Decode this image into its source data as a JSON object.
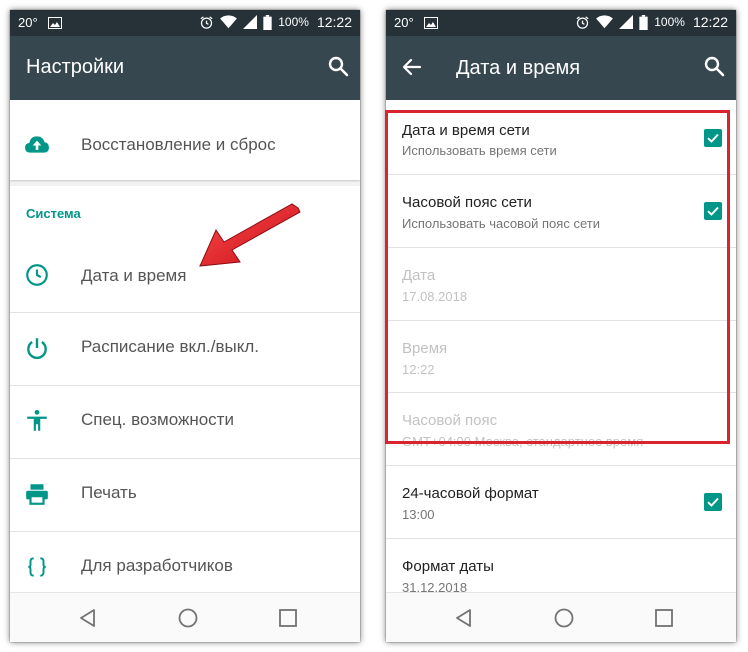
{
  "colors": {
    "statusbar_bg": "#263238",
    "appbar_bg": "#37474f",
    "accent_teal": "#009688",
    "highlight_red": "#d9232e"
  },
  "left": {
    "status": {
      "temp": "20°",
      "battery": "100%",
      "time": "12:22"
    },
    "title": "Настройки",
    "items_top": [
      {
        "label": "Восстановление и сброс",
        "icon": "cloud-upload-icon"
      }
    ],
    "section_header": "Система",
    "system_items": [
      {
        "label": "Дата и время",
        "icon": "clock-icon"
      },
      {
        "label": "Расписание вкл./выкл.",
        "icon": "power-icon"
      },
      {
        "label": "Спец. возможности",
        "icon": "accessibility-icon"
      },
      {
        "label": "Печать",
        "icon": "printer-icon"
      },
      {
        "label": "Для разработчиков",
        "icon": "developer-braces-icon"
      }
    ]
  },
  "right": {
    "status": {
      "temp": "20°",
      "battery": "100%",
      "time": "12:22"
    },
    "title": "Дата и время",
    "prefs": [
      {
        "title": "Дата и время сети",
        "summary": "Использовать время сети",
        "checked": true,
        "enabled": true
      },
      {
        "title": "Часовой пояс сети",
        "summary": "Использовать часовой пояс сети",
        "checked": true,
        "enabled": true
      },
      {
        "title": "Дата",
        "summary": "17.08.2018",
        "enabled": false
      },
      {
        "title": "Время",
        "summary": "12:22",
        "enabled": false
      },
      {
        "title": "Часовой пояс",
        "summary": "GMT+04:00 Москва, стандартное время",
        "enabled": false
      },
      {
        "title": "24-часовой формат",
        "summary": "13:00",
        "checked": true,
        "enabled": true
      },
      {
        "title": "Формат даты",
        "summary": "31.12.2018",
        "enabled": true
      }
    ]
  }
}
